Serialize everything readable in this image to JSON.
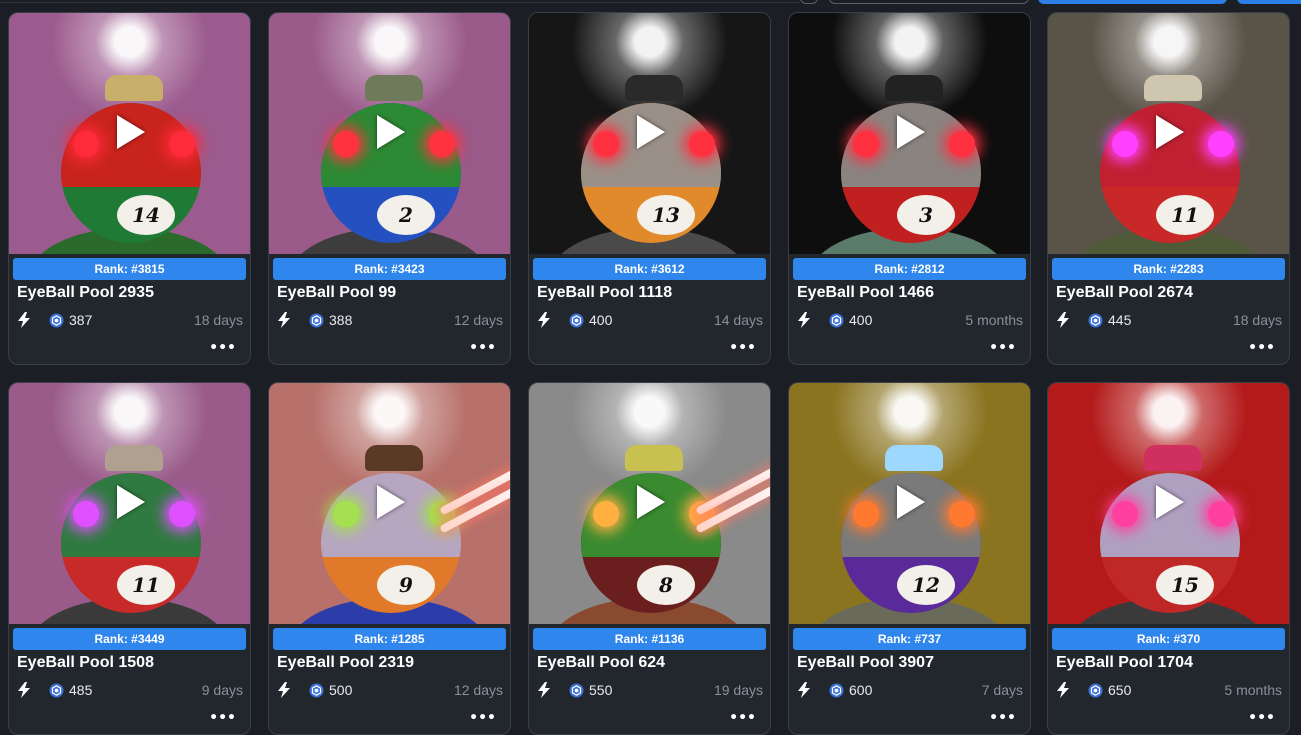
{
  "toolbar": {
    "search_placeholder": "",
    "primary_action": "",
    "secondary_action": ""
  },
  "theme": {
    "accent": "#2f86ec",
    "card_bg": "#22262d",
    "page_bg": "#1b1e24",
    "muted_text": "#8b9099"
  },
  "cards": [
    {
      "rank": "Rank: #3815",
      "title": "EyeBall Pool 2935",
      "price": "387",
      "ago": "18 days",
      "number": "14",
      "bg": "#9c5b8e",
      "ball": "#1f7a36",
      "band": "#c8241c",
      "eyes": "#ff2a3a",
      "hat": "#c9b06a",
      "bust": "#2a6a2a"
    },
    {
      "rank": "Rank: #3423",
      "title": "EyeBall Pool 99",
      "price": "388",
      "ago": "12 days",
      "number": "2",
      "bg": "#9a5a8a",
      "ball": "#2550c0",
      "band": "#2c8a34",
      "eyes": "#ff3340",
      "hat": "#6f7a5a",
      "bust": "#3d3d3d"
    },
    {
      "rank": "Rank: #3612",
      "title": "EyeBall Pool 1118",
      "price": "400",
      "ago": "14 days",
      "number": "13",
      "bg": "#161616",
      "ball": "#e08a2c",
      "band": "#9a9088",
      "eyes": "#ff3040",
      "hat": "#2a2a2a",
      "bust": "#4a4a4a"
    },
    {
      "rank": "Rank: #2812",
      "title": "EyeBall Pool 1466",
      "price": "400",
      "ago": "5 months",
      "number": "3",
      "bg": "#0e0e0e",
      "ball": "#c02020",
      "band": "#8a8480",
      "eyes": "#ff3040",
      "hat": "#222222",
      "bust": "#5a7a6a"
    },
    {
      "rank": "Rank: #2283",
      "title": "EyeBall Pool 2674",
      "price": "445",
      "ago": "18 days",
      "number": "11",
      "bg": "#5a5348",
      "ball": "#c82828",
      "band": "#c02030",
      "eyes": "#ff40ff",
      "hat": "#cfc6b0",
      "bust": "#4e5a38"
    },
    {
      "rank": "Rank: #3449",
      "title": "EyeBall Pool 1508",
      "price": "485",
      "ago": "9 days",
      "number": "11",
      "bg": "#9a5b8b",
      "ball": "#c82a2a",
      "band": "#2f7a40",
      "eyes": "#e050ff",
      "hat": "#b0a090",
      "bust": "#3a3a3a"
    },
    {
      "rank": "Rank: #1285",
      "title": "EyeBall Pool 2319",
      "price": "500",
      "ago": "12 days",
      "number": "9",
      "bg": "#b7706a",
      "ball": "#e07a2a",
      "band": "#b6a6c0",
      "eyes": "#a4e050",
      "hat": "#5a3a24",
      "bust": "#2c3ca8"
    },
    {
      "rank": "Rank: #1136",
      "title": "EyeBall Pool 624",
      "price": "550",
      "ago": "19 days",
      "number": "8",
      "bg": "#8a8a8a",
      "ball": "#6a1e1e",
      "band": "#3a8a30",
      "eyes": "#ffb040",
      "hat": "#c8c050",
      "bust": "#8a4a30"
    },
    {
      "rank": "Rank: #737",
      "title": "EyeBall Pool 3907",
      "price": "600",
      "ago": "7 days",
      "number": "12",
      "bg": "#8a7420",
      "ball": "#5a2a9a",
      "band": "#7a7a7a",
      "eyes": "#ff7a30",
      "hat": "#9cd8ff",
      "bust": "#6a6a5a"
    },
    {
      "rank": "Rank: #370",
      "title": "EyeBall Pool 1704",
      "price": "650",
      "ago": "5 months",
      "number": "15",
      "bg": "#b41a1a",
      "ball": "#c02828",
      "band": "#b0a0c0",
      "eyes": "#ff40a0",
      "hat": "#d03060",
      "bust": "#3a3a3a"
    }
  ]
}
